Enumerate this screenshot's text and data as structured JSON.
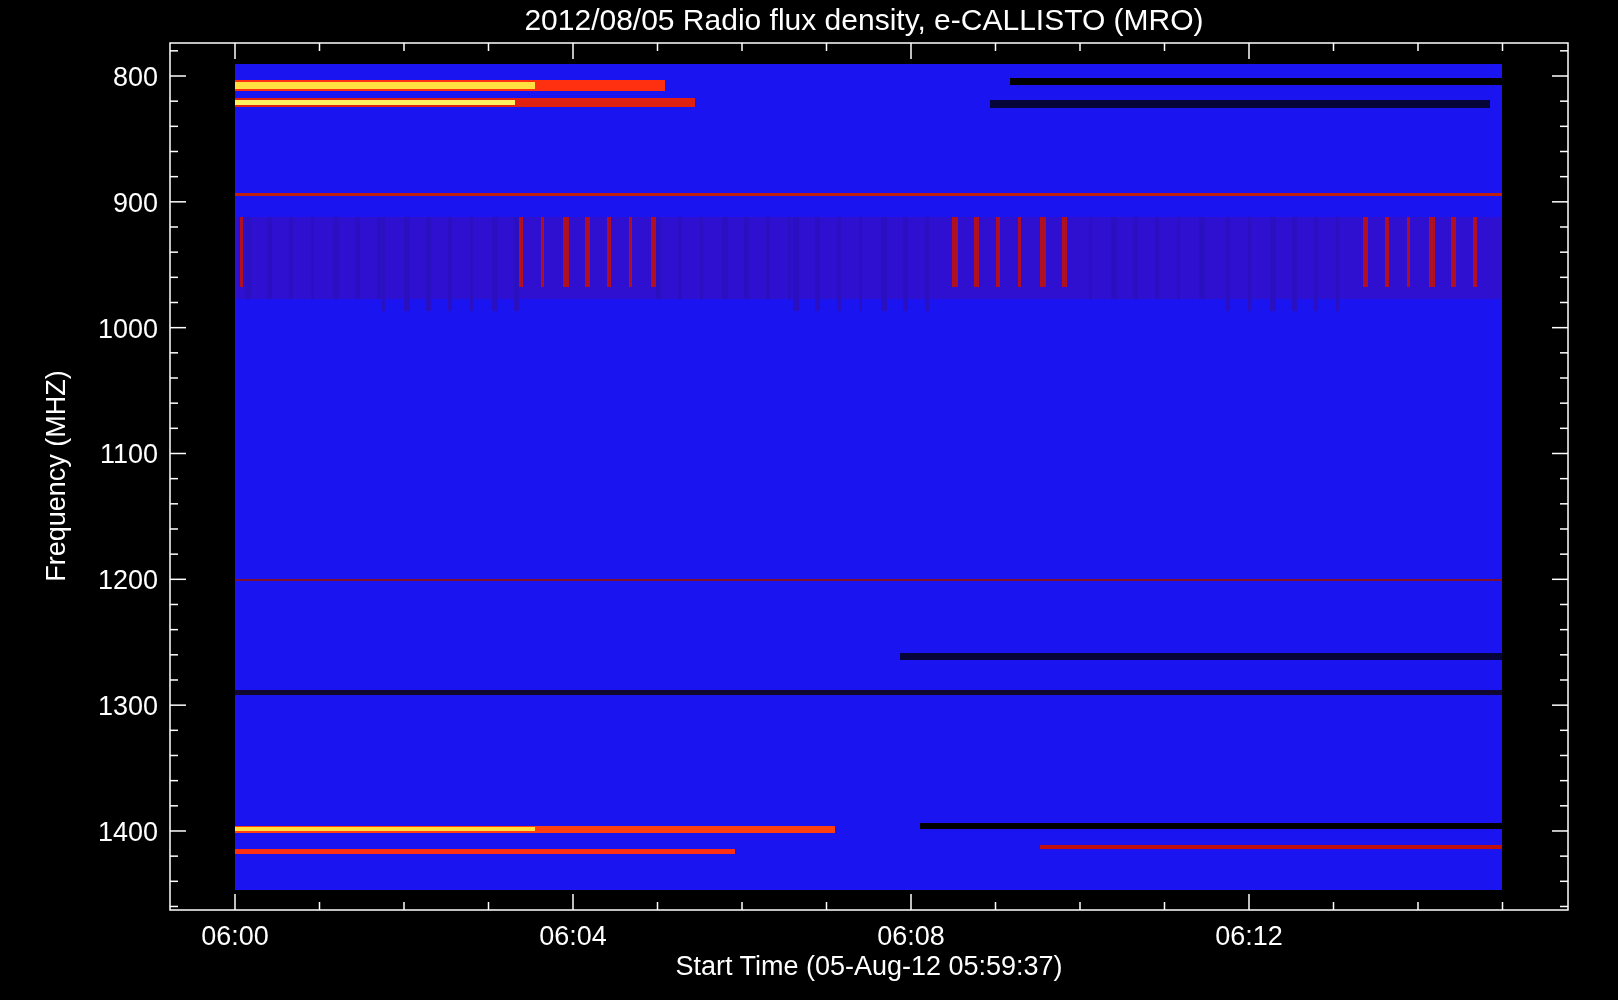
{
  "title": "2012/08/05  Radio flux density, e-CALLISTO (MRO)",
  "y_axis": {
    "label": "Frequency (MHZ)",
    "ticks": [
      "800",
      "900",
      "1000",
      "1100",
      "1200",
      "1300",
      "1400"
    ]
  },
  "x_axis": {
    "label": "Start Time (05-Aug-12 05:59:37)",
    "ticks": [
      "06:00",
      "06:04",
      "06:08",
      "06:12"
    ]
  }
}
